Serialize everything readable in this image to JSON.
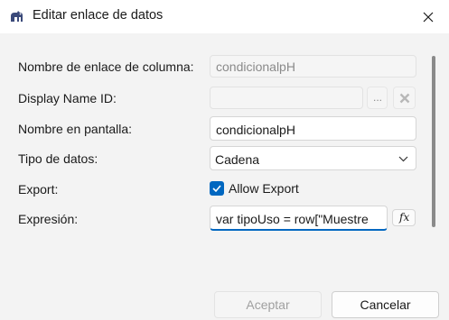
{
  "window": {
    "title": "Editar enlace de datos",
    "app_icon": "data-link-icon"
  },
  "form": {
    "column_link_name": {
      "label": "Nombre de enlace de columna:",
      "value": "condicionalpH"
    },
    "display_name_id": {
      "label": "Display Name ID:",
      "value": "",
      "browse_label": "...",
      "clear_icon": "x-icon"
    },
    "display_name": {
      "label": "Nombre en pantalla:",
      "value": "condicionalpH"
    },
    "data_type": {
      "label": "Tipo de datos:",
      "value": "Cadena",
      "icon": "chevron-down-icon"
    },
    "export": {
      "label": "Export:",
      "checkbox_label": "Allow Export",
      "checked": true
    },
    "expression": {
      "label": "Expresión:",
      "value": "var tipoUso = row[\"Muestre",
      "fx_label": "fx"
    }
  },
  "buttons": {
    "accept": "Aceptar",
    "cancel": "Cancelar"
  },
  "colors": {
    "accent": "#0067c0"
  }
}
